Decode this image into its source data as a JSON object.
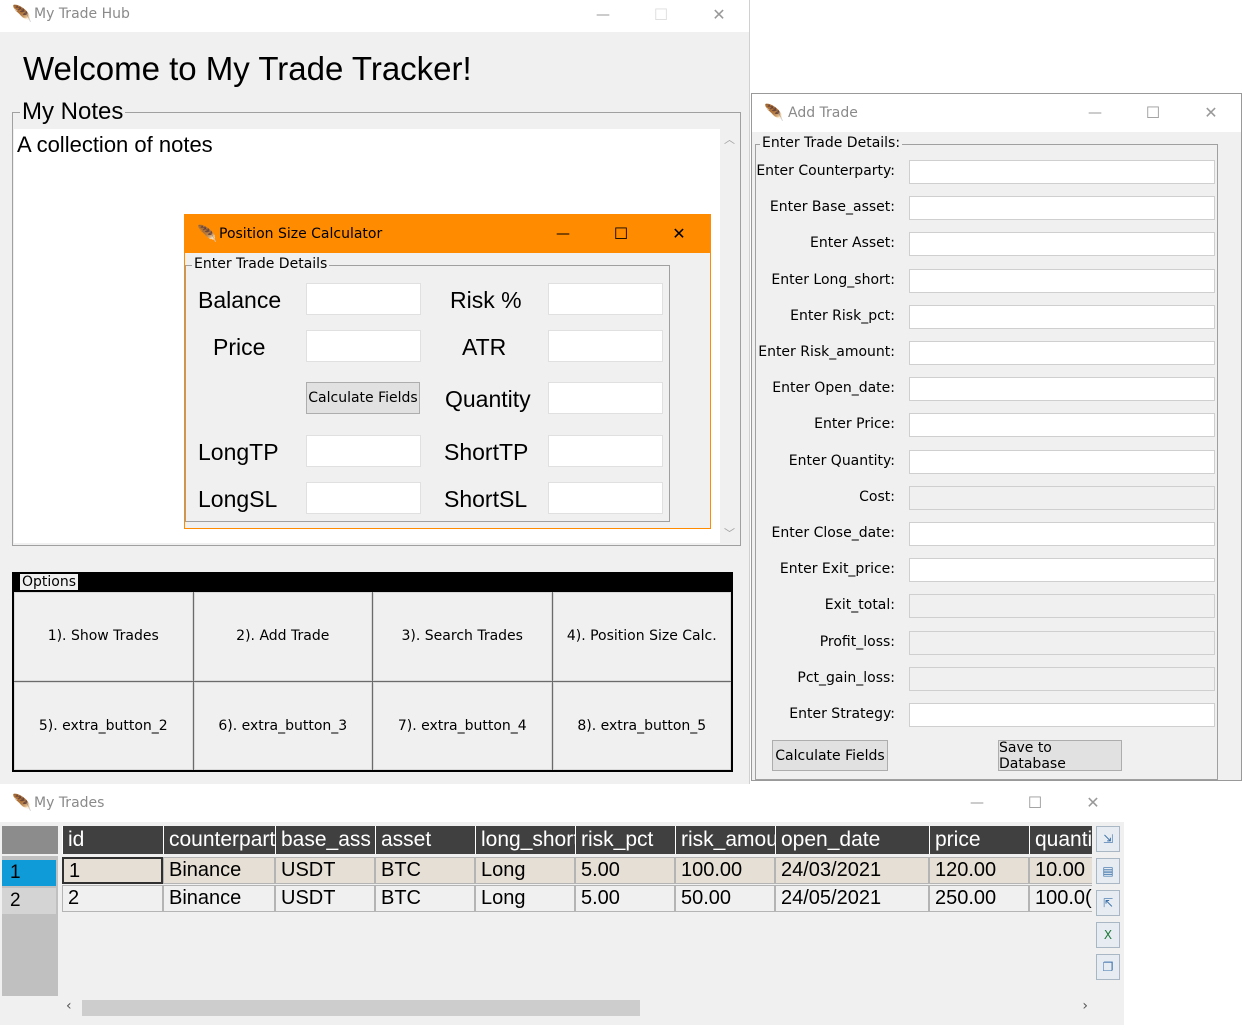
{
  "hub": {
    "title": "My Trade Hub",
    "welcome": "Welcome to My Trade Tracker!",
    "notes_legend": "My Notes",
    "notes_text": "A collection of notes",
    "options_legend": "Options",
    "options": [
      "1). Show Trades",
      "2). Add Trade",
      "3). Search Trades",
      "4). Position Size Calc.",
      "5). extra_button_2",
      "6). extra_button_3",
      "7). extra_button_4",
      "8). extra_button_5"
    ]
  },
  "calc": {
    "title": "Position Size Calculator",
    "legend": "Enter Trade Details",
    "labels": {
      "balance": "Balance",
      "risk": "Risk %",
      "price": "Price",
      "atr": "ATR",
      "quantity": "Quantity",
      "longtp": "LongTP",
      "shorttp": "ShortTP",
      "longsl": "LongSL",
      "shortsl": "ShortSL"
    },
    "calculate_button": "Calculate Fields",
    "accent_color": "#ff8c00"
  },
  "add_trade": {
    "title": "Add Trade",
    "legend": "Enter Trade Details:",
    "fields": [
      {
        "label": "Enter Counterparty:",
        "readonly": false
      },
      {
        "label": "Enter Base_asset:",
        "readonly": false
      },
      {
        "label": "Enter Asset:",
        "readonly": false
      },
      {
        "label": "Enter Long_short:",
        "readonly": false
      },
      {
        "label": "Enter Risk_pct:",
        "readonly": false
      },
      {
        "label": "Enter Risk_amount:",
        "readonly": false
      },
      {
        "label": "Enter Open_date:",
        "readonly": false
      },
      {
        "label": "Enter Price:",
        "readonly": false
      },
      {
        "label": "Enter Quantity:",
        "readonly": false
      },
      {
        "label": "Cost:",
        "readonly": true
      },
      {
        "label": "Enter Close_date:",
        "readonly": false
      },
      {
        "label": "Enter Exit_price:",
        "readonly": false
      },
      {
        "label": "Exit_total:",
        "readonly": true
      },
      {
        "label": "Profit_loss:",
        "readonly": true
      },
      {
        "label": "Pct_gain_loss:",
        "readonly": true
      },
      {
        "label": "Enter Strategy:",
        "readonly": false
      }
    ],
    "calculate_button": "Calculate Fields",
    "save_button": "Save to Database"
  },
  "trades": {
    "title": "My Trades",
    "columns": [
      "id",
      "counterpart",
      "base_ass",
      "asset",
      "long_short",
      "risk_pct",
      "risk_amou",
      "open_date",
      "price",
      "quanti"
    ],
    "row_headers": [
      "1",
      "2"
    ],
    "rows": [
      [
        "1",
        "Binance",
        "USDT",
        "BTC",
        "Long",
        "5.00",
        "100.00",
        "24/03/2021",
        "120.00",
        "10.00"
      ],
      [
        "2",
        "Binance",
        "USDT",
        "BTC",
        "Long",
        "5.00",
        "50.00",
        "24/05/2021",
        "250.00",
        "100.0("
      ]
    ],
    "selected_row_color": "#0f9bd7",
    "header_color": "#404040"
  },
  "window_controls": {
    "minimize": "—",
    "maximize": "☐",
    "close": "✕"
  },
  "icons": {
    "app": "feather-icon"
  }
}
